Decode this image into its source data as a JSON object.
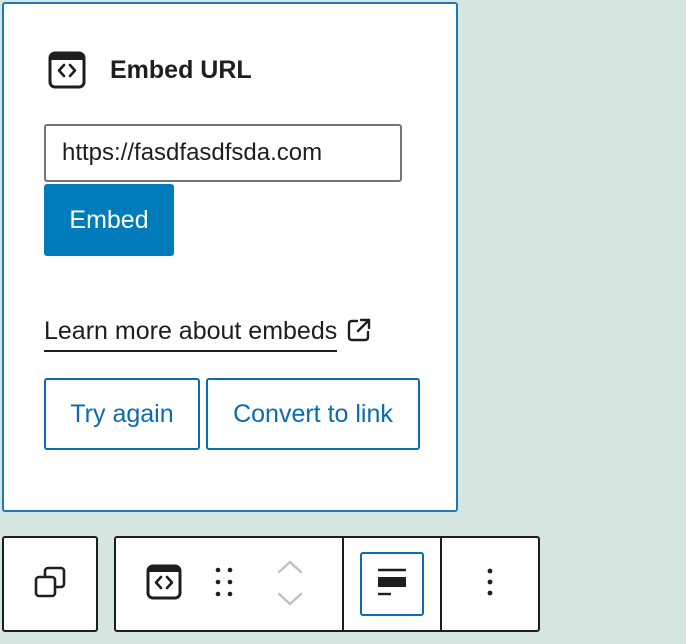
{
  "embed_block": {
    "title": "Embed URL",
    "url_value": "https://fasdfasdfsda.com",
    "embed_button_label": "Embed",
    "learn_more_label": "Learn more about embeds",
    "try_again_label": "Try again",
    "convert_label": "Convert to link"
  },
  "toolbar": {
    "items": [
      {
        "icon": "block-switcher-icon"
      },
      {
        "icon": "embed-block-icon"
      },
      {
        "icon": "drag-handle-icon"
      },
      {
        "icon": "move-up-icon"
      },
      {
        "icon": "move-down-icon"
      },
      {
        "icon": "align-left-icon"
      },
      {
        "icon": "more-options-icon"
      }
    ]
  },
  "colors": {
    "accent": "#007cba",
    "card_border": "#1c7bb6",
    "background": "#d5e5df",
    "text": "#1e1e1e"
  }
}
